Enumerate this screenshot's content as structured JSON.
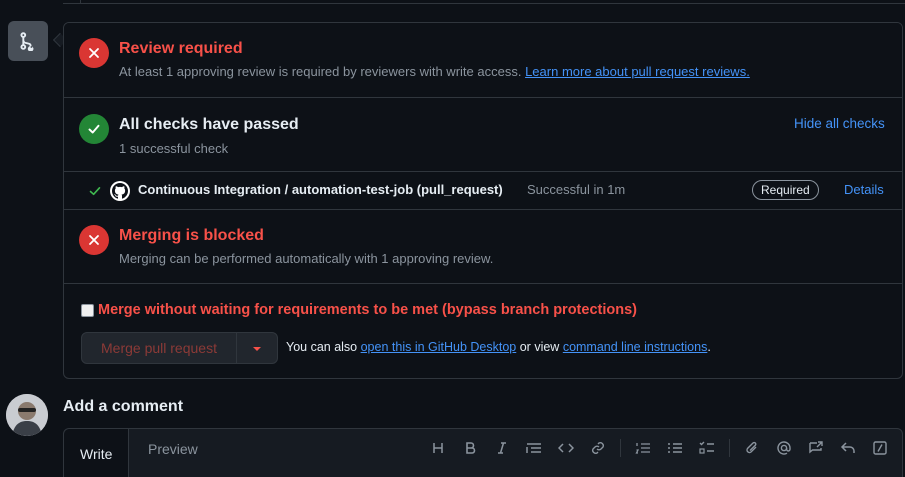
{
  "review": {
    "title": "Review required",
    "subtitle": "At least 1 approving review is required by reviewers with write access.",
    "link": "Learn more about pull request reviews."
  },
  "checks": {
    "title": "All checks have passed",
    "subtitle": "1 successful check",
    "toggle": "Hide all checks",
    "job": {
      "name": "Continuous Integration / automation-test-job (pull_request)",
      "status": "Successful in 1m",
      "badge": "Required",
      "details": "Details"
    }
  },
  "blocked": {
    "title": "Merging is blocked",
    "subtitle": "Merging can be performed automatically with 1 approving review."
  },
  "merge": {
    "bypass_label": "Merge without waiting for requirements to be met (bypass branch protections)",
    "button": "Merge pull request",
    "hint_prefix": "You can also",
    "hint_link1": "open this in GitHub Desktop",
    "hint_mid": "or view",
    "hint_link2": "command line instructions",
    "hint_suffix": "."
  },
  "comment": {
    "heading": "Add a comment",
    "tabs": [
      "Write",
      "Preview"
    ],
    "toolbar_icons": [
      "heading-icon",
      "bold-icon",
      "italic-icon",
      "quote-icon",
      "code-icon",
      "link-icon",
      "ordered-list-icon",
      "unordered-list-icon",
      "task-list-icon",
      "attach-icon",
      "mention-icon",
      "reference-icon",
      "reply-icon",
      "slash-command-icon"
    ]
  },
  "colors": {
    "danger": "#f85149",
    "success": "#238636",
    "accent": "#4493f8",
    "background": "#0d1117"
  }
}
